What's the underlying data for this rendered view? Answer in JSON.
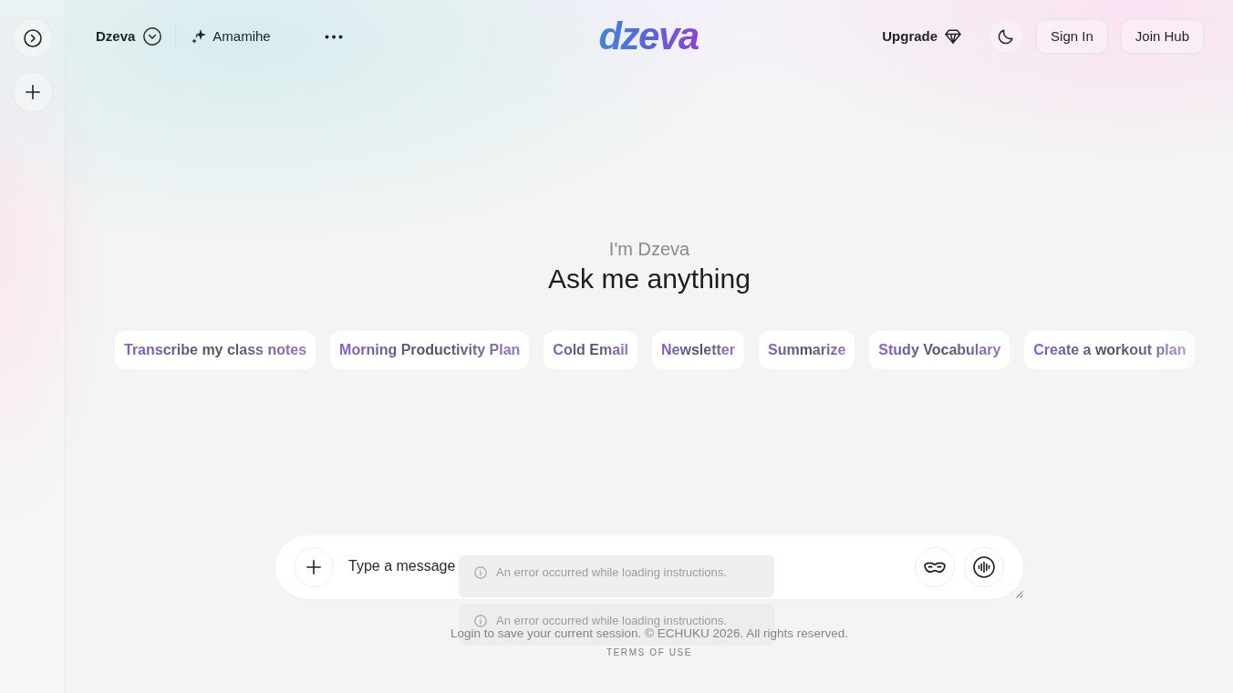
{
  "header": {
    "model": "Dzeva",
    "assistant": "Amamihe",
    "logo": "dzeva",
    "upgrade": "Upgrade",
    "buttons": [
      "Sign In",
      "Join Hub"
    ]
  },
  "hero": {
    "greeting": "I'm Dzeva",
    "title": "Ask me anything"
  },
  "suggestions": [
    "Transcribe my class notes",
    "Morning Productivity Plan",
    "Cold Email",
    "Newsletter",
    "Summarize",
    "Study Vocabulary",
    "Create a workout plan"
  ],
  "composer": {
    "placeholder": "Type a message"
  },
  "toasts": [
    "An error occurred while loading instructions.",
    "An error occurred while loading instructions."
  ],
  "footer": {
    "notice": "Login to save your current session. © ECHUKU 2026. All rights reserved.",
    "link": "TERMS OF USE"
  }
}
